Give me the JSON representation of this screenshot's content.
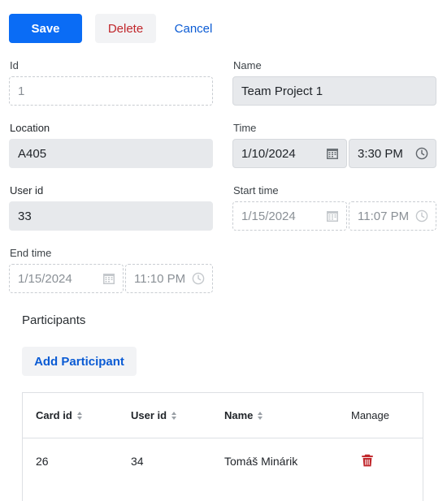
{
  "toolbar": {
    "save_label": "Save",
    "delete_label": "Delete",
    "cancel_label": "Cancel"
  },
  "form": {
    "id": {
      "label": "Id",
      "placeholder": "1"
    },
    "name": {
      "label": "Name",
      "value": "Team Project 1"
    },
    "location": {
      "label": "Location",
      "value": "A405"
    },
    "time": {
      "label": "Time",
      "date": "1/10/2024",
      "time": "3:30 PM"
    },
    "user_id": {
      "label": "User id",
      "value": "33"
    },
    "start_time": {
      "label": "Start time",
      "date": "1/15/2024",
      "time": "11:07 PM"
    },
    "end_time": {
      "label": "End time",
      "date": "1/15/2024",
      "time": "11:10 PM"
    }
  },
  "participants": {
    "title": "Participants",
    "add_label": "Add Participant",
    "columns": [
      "Card id",
      "User id",
      "Name",
      "Manage"
    ],
    "rows": [
      {
        "card_id": "26",
        "user_id": "34",
        "name": "Tomáš Minárik"
      }
    ]
  },
  "colors": {
    "primary": "#0a6cf5",
    "danger": "#c0262b",
    "link": "#0a5bd4"
  },
  "icons": {
    "calendar": "calendar-icon",
    "clock": "clock-icon",
    "sort": "sort-icon",
    "trash": "trash-icon"
  }
}
